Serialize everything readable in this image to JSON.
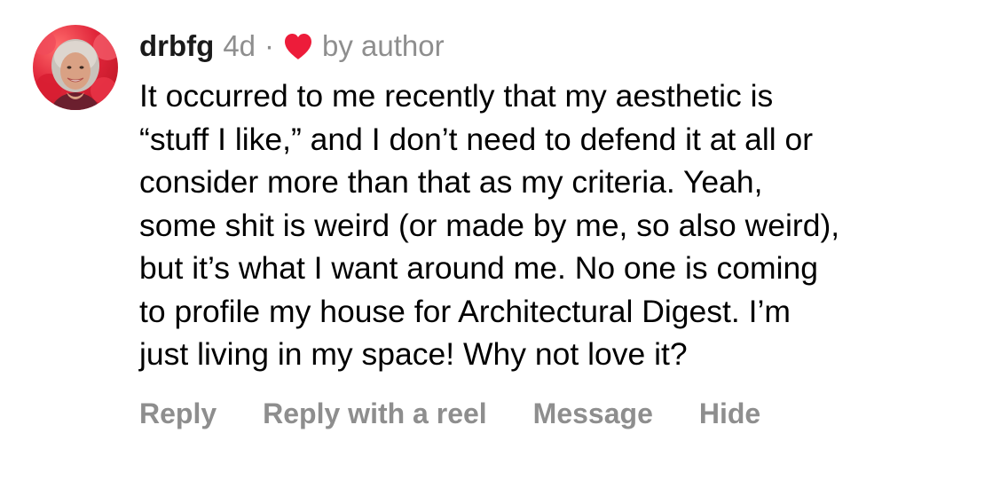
{
  "comment": {
    "username": "drbfg",
    "time": "4d",
    "separator": "·",
    "liked_icon": "heart-icon",
    "like_color": "#ed1c3a",
    "by_author": "by author",
    "text": "It occurred to me recently that my aesthetic is\n“stuff I like,” and I don’t need to defend it at all or\nconsider more than that as my criteria. Yeah,\nsome shit is weird (or made by me, so also weird),\nbut it’s what I want around me. No one is coming\nto profile my house for Architectural Digest. I’m\njust living in my space! Why not love it?"
  },
  "actions": {
    "reply": "Reply",
    "reply_with_reel": "Reply with a reel",
    "message": "Message",
    "hide": "Hide"
  },
  "colors": {
    "secondary_text": "#8e8e8e",
    "primary_text": "#000000"
  }
}
